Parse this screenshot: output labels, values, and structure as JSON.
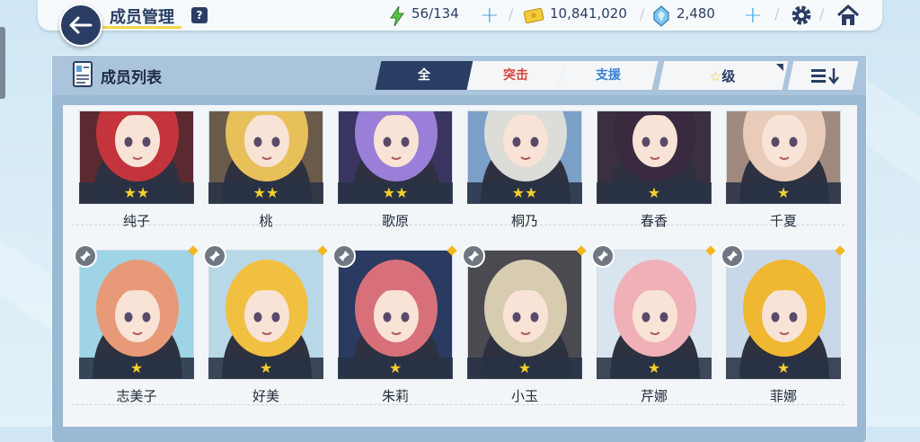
{
  "header": {
    "title": "成员管理",
    "help_label": "?",
    "ap": "56/134",
    "credits": "10,841,020",
    "pyroxene": "2,480"
  },
  "panel": {
    "title": "成员列表",
    "tabs": [
      "全",
      "突击",
      "支援"
    ],
    "sort_label": "级"
  },
  "students_row1": [
    {
      "name": "纯子",
      "stars": "★★",
      "hair": "#c4343c",
      "bg": "#5a2a30"
    },
    {
      "name": "桃",
      "stars": "★★",
      "hair": "#e8c05a",
      "bg": "#6a5a4a"
    },
    {
      "name": "歌原",
      "stars": "★★",
      "hair": "#9a7fd8",
      "bg": "#3a3560"
    },
    {
      "name": "桐乃",
      "stars": "★★",
      "hair": "#dcdcd8",
      "bg": "#7aa0c8"
    },
    {
      "name": "春香",
      "stars": "★",
      "hair": "#3a2a40",
      "bg": "#3a3040"
    },
    {
      "name": "千夏",
      "stars": "★",
      "hair": "#e8cbb8",
      "bg": "#a08a80"
    }
  ],
  "students_row2": [
    {
      "name": "志美子",
      "stars": "★",
      "hair": "#e89a78",
      "bg": "#9fd3e6"
    },
    {
      "name": "好美",
      "stars": "★",
      "hair": "#f2c040",
      "bg": "#b8d8e8"
    },
    {
      "name": "朱莉",
      "stars": "★",
      "hair": "#d8707a",
      "bg": "#2a3a60"
    },
    {
      "name": "小玉",
      "stars": "★",
      "hair": "#d8ccb0",
      "bg": "#4a4a50"
    },
    {
      "name": "芹娜",
      "stars": "★",
      "hair": "#f0b0b8",
      "bg": "#d8e4ee"
    },
    {
      "name": "菲娜",
      "stars": "★",
      "hair": "#f0b830",
      "bg": "#c8d8e8"
    }
  ],
  "colors": {
    "navy": "#2a3e63",
    "accent_yellow": "#f2d64a",
    "striker_red": "#d9463e",
    "special_blue": "#3a7fcf"
  }
}
